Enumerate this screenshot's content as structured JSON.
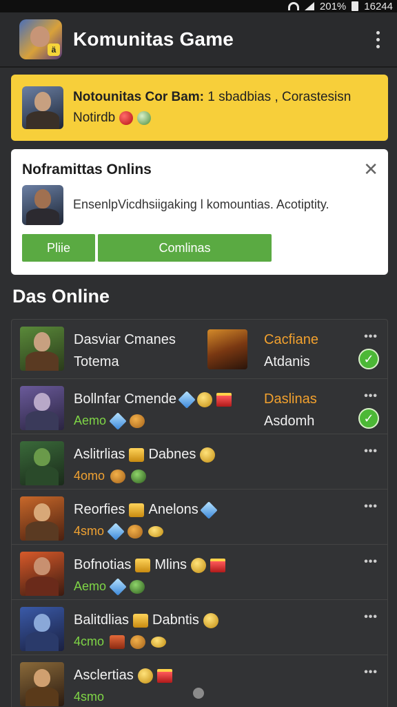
{
  "status_bar": {
    "battery": "201%",
    "time": "16244"
  },
  "header": {
    "title": "Komunitas Game"
  },
  "notice": {
    "line1_bold": "Notounitas Cor Bam:",
    "line1_rest": " 1 sbadbias , Corastesisn",
    "line2": "Notirdb"
  },
  "card": {
    "title": "Noframittas Onlins",
    "close": "✕",
    "message": "EnsenlpVicdhsiigaking l komountias. Acotiptity.",
    "primary_button": "Pliie",
    "secondary_button": "Comlinas"
  },
  "section_title": "Das Online",
  "rows": [
    {
      "name": "Dasviar Cmanes",
      "sub": "Totema",
      "status_top": "Cacfiane",
      "status_bot": "Atdanis",
      "dots": "•••",
      "check": "✓"
    },
    {
      "name": "Bollnfar Cmende",
      "sub": "Aemo",
      "status_top": "Daslinas",
      "status_bot": "Asdomh",
      "dots": "•••",
      "check": "✓"
    },
    {
      "name": "Aslitrlias",
      "tag": "Dabnes",
      "sub": "4omo",
      "dots": "•••"
    },
    {
      "name": "Reorfies",
      "tag": "Anelons",
      "sub": "4smo",
      "dots": "•••"
    },
    {
      "name": "Bofnotias",
      "tag": "Mlins",
      "sub": "Aemo",
      "dots": "•••"
    },
    {
      "name": "Balitdlias",
      "tag": "Dabntis",
      "sub": "4cmo",
      "dots": "•••"
    },
    {
      "name": "Asclertias",
      "sub": "4smo",
      "dots": "•••"
    }
  ],
  "colors": {
    "accent_yellow": "#f7cf3a",
    "accent_green": "#5aaa42",
    "status_orange": "#f2a12e",
    "online_green": "#7fd646"
  }
}
